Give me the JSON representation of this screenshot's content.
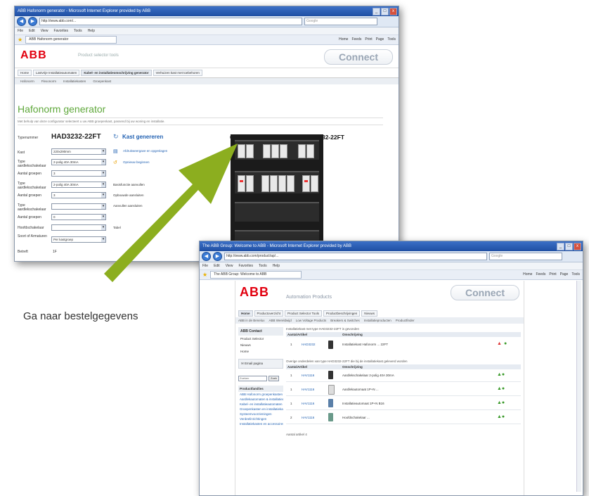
{
  "caption": "Ga naar bestelgegevens",
  "win1": {
    "titlebar": "ABB Hafonorm generator - Microsoft Internet Explorer provided by ABB",
    "url": "http://www.abb.com/...",
    "menu": [
      "File",
      "Edit",
      "View",
      "Favorites",
      "Tools",
      "Help"
    ],
    "tab": "ABB Hafonorm generator",
    "toolbar_right": [
      "Home",
      "Feeds",
      "Print",
      "Page",
      "Tools"
    ],
    "logo": "ABB",
    "tagline": "Product selector tools",
    "connect": "Connect",
    "navtabs": [
      "Home",
      "Lastvrije Installatieautomaten",
      "Kabel- en installatieomschrijving generator",
      "Verhuizen kast met toebehoren"
    ],
    "subtabs": [
      "Hafonorm",
      "Flexonorm",
      "Installatiekasten",
      "Groepenkast"
    ],
    "heading": "Hafonorm generator",
    "intro": "Met behulp van deze configurator selecteert u uw ABB groepenkast, passend bij uw woning en installatie.",
    "type_label": "Typenummer",
    "type_value": "HAD3232-22FT",
    "generate_button": "Kast genereren",
    "order_link": "Ga naar bestelgegevens: HAD3232-22FT",
    "form": [
      {
        "label": "Kast",
        "value": "220x290mm"
      },
      {
        "label": "Type aardlekschakelaar",
        "value": "2-polig 40A 30mA"
      },
      {
        "label": "Aantal groepen",
        "value": "3"
      },
      {
        "label": "Type aardlekschakelaar",
        "value": "2-polig 40A 30mA"
      },
      {
        "label": "Aantal groepen",
        "value": "3"
      },
      {
        "label": "Type aardlekschakelaar",
        "value": ""
      },
      {
        "label": "Aantal groepen",
        "value": "0"
      },
      {
        "label": "Hoofdschakelaar",
        "value": ""
      },
      {
        "label": "Soort of Armaturen",
        "value": "Per kastgroep"
      },
      {
        "label": "Betreft",
        "value": "1F"
      }
    ],
    "mid_links": [
      "Afdrukweergave en opgeslagen",
      "Opnieuw beginnen"
    ],
    "mid_labels": [
      "Basisfunctie aanvullen",
      "Opbouwde aansluiten",
      "Aanvullen aansluiten",
      "Tabel"
    ]
  },
  "win2": {
    "titlebar": "The ABB Group: Welcome to ABB - Microsoft Internet Explorer provided by ABB",
    "url": "http://www.abb.com/product/ap/...",
    "menu": [
      "File",
      "Edit",
      "View",
      "Favorites",
      "Tools",
      "Help"
    ],
    "tab": "The ABB Group: Welcome to ABB",
    "toolbar_right": [
      "Home",
      "Feeds",
      "Print",
      "Page",
      "Tools"
    ],
    "logo": "ABB",
    "tagline": "Automation Products",
    "connect": "Connect",
    "navtabs": [
      "Home",
      "Productoverzicht",
      "Product Selector Tools",
      "Productbeschrijvingen",
      "Nieuws"
    ],
    "subtabs": [
      "ABB in de Benelux",
      "ABB Wereldwijd",
      "Low Voltage Products",
      "Breakers & Switches",
      "Installatieproducten",
      "Productfinder"
    ],
    "sidebar_title": "ABB Contact",
    "sidebar_links": [
      "Product Selector",
      "Nieuws",
      "Home"
    ],
    "search_placeholder": "Zoeken",
    "search_button": "Zoek",
    "sidebar_section": "Productfamilies",
    "sidebar_items": [
      "ABB Hafonorm groepenkasten",
      "Aardlekautomaten & installatieautomaten",
      "Kabel- en installatieautomaten",
      "Groepenkasten en installatiekasten",
      "Systeemvoorzieningen",
      "Verdeelinrichtingen",
      "Installatiekasten en accessoires"
    ],
    "table1_title": "Installatiekast met type HAD3232-22FT is gevonden",
    "table1_headers": [
      "Aantal",
      "Artikel",
      "Omschrijving"
    ],
    "table1_rows": [
      {
        "qty": "1",
        "art": "HAD3232",
        "desc": "Installatiekast Hafonorm ... 22FT"
      }
    ],
    "table2_title": "Overige onderdelen van type HAD3232-22FT die bij de installatiekast geleverd worden",
    "table2_headers": [
      "Aantal",
      "Artikel",
      "Omschrijving"
    ],
    "table2_rows": [
      {
        "qty": "1",
        "art": "HAV1116",
        "desc": "Aardlekschakelaar 2-polig 40A 30mA"
      },
      {
        "qty": "1",
        "art": "HAV1116",
        "desc": "Aardlekautomaat 1P+N ..."
      },
      {
        "qty": "1",
        "art": "HAV1116",
        "desc": "Installatieautomaat 1P+N B16"
      },
      {
        "qty": "2",
        "art": "HAV1116",
        "desc": "Hoofdschakelaar ..."
      }
    ],
    "total_label": "Aantal artikel 4"
  },
  "colors": {
    "abb_red": "#e2000f",
    "arrow_green": "#8cae1f",
    "heading_green": "#5fa83b"
  }
}
